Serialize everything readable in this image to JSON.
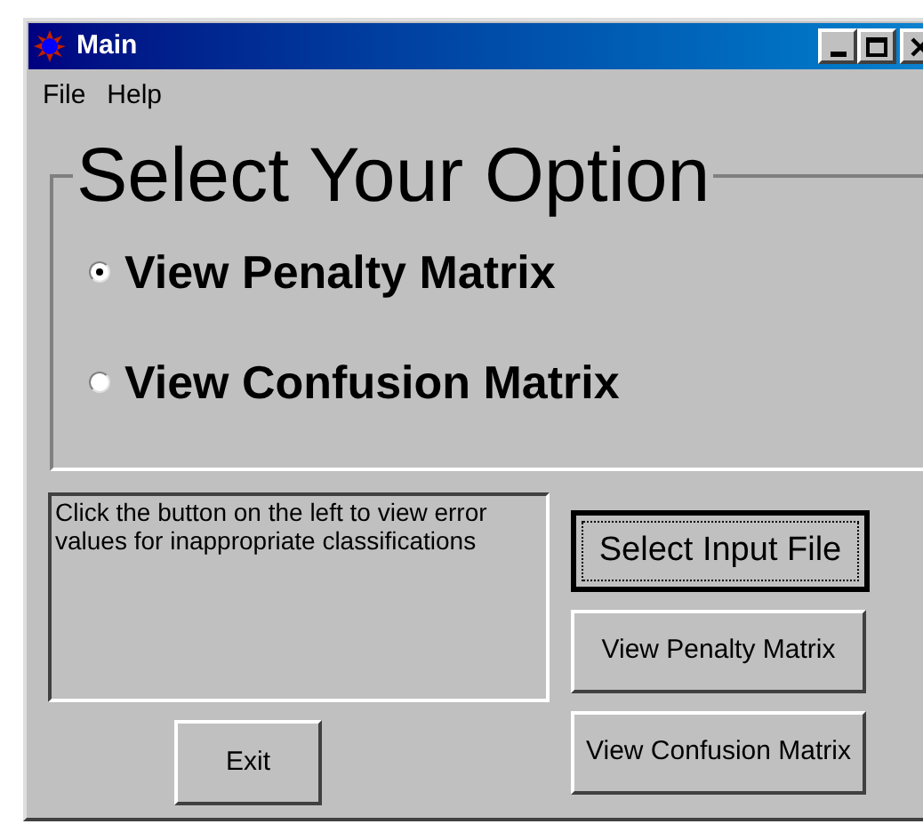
{
  "window": {
    "title": "Main"
  },
  "menu": [
    "File",
    "Help"
  ],
  "group": {
    "title": "Select Your Option",
    "options": [
      {
        "label": "View Penalty Matrix",
        "selected": true
      },
      {
        "label": "View Confusion Matrix",
        "selected": false
      }
    ]
  },
  "info_box": {
    "text": "Click the button on the left to view error values for inappropriate classifications"
  },
  "buttons": [
    {
      "label": "Select Input File",
      "kind": "default"
    },
    {
      "label": "View Penalty Matrix",
      "kind": "normal"
    },
    {
      "label": "View Confusion Matrix",
      "kind": "normal"
    }
  ],
  "exit_button": {
    "label": "Exit"
  }
}
